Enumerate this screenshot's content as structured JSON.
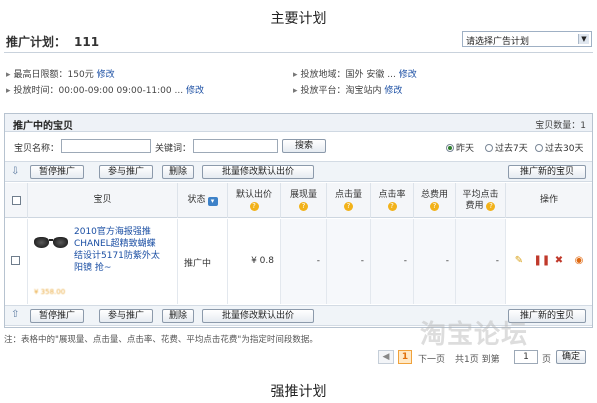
{
  "captions": {
    "top": "主要计划",
    "bottom": "强推计划"
  },
  "plan": {
    "label": "推广计划：",
    "number": "111",
    "select_value": "请选择广告计划"
  },
  "settings": {
    "daily_limit_label": "最高日限额：150元",
    "daily_limit_edit": "修改",
    "time_label": "投放时间：00:00-09:00 09:00-11:00 ...",
    "time_edit": "修改",
    "region_label": "投放地域：国外 安徽 ...",
    "region_edit": "修改",
    "platform_label": "投放平台：淘宝站内",
    "platform_edit": "修改"
  },
  "panel": {
    "title": "推广中的宝贝",
    "count": "宝贝数量：1"
  },
  "search": {
    "name_label": "宝贝名称：",
    "keyword_label": "关键词：",
    "search_button": "搜索",
    "range_options": [
      "昨天",
      "过去7天",
      "过去30天"
    ],
    "selected_range": "昨天"
  },
  "actions": {
    "pause": "暂停推广",
    "join": "参与推广",
    "delete": "删除",
    "batch_bid": "批量修改默认出价",
    "promote_new": "推广新的宝贝"
  },
  "table": {
    "headers": {
      "item": "宝贝",
      "status": "状态",
      "default_bid_1": "默认出价",
      "impressions": "展现量",
      "clicks": "点击量",
      "ctr": "点击率",
      "total_cost": "总费用",
      "avg_cpc_1": "平均点击",
      "avg_cpc_2": "费用",
      "operations": "操作"
    },
    "rows": [
      {
        "title": "2010官方海报强推CHANEL超精致蝴蝶结设计5171防紫外太阳镜 抢~",
        "price": "¥ 358.00",
        "status": "推广中",
        "bid": "¥ 0.8",
        "impressions": "-",
        "clicks": "-",
        "ctr": "-",
        "cost": "-",
        "avg_cpc": "-"
      }
    ]
  },
  "note": "注：表格中的\"展现量、点击量、点击率、花费、平均点击花费\"为指定时间段数据。",
  "pager": {
    "prev_glyph": "◀",
    "current_page": "1",
    "next_label": "下一页",
    "total_label": "共1页 到第",
    "goto_value": "1",
    "page_suffix": "页",
    "confirm": "确定"
  },
  "watermark": "淘宝论坛"
}
